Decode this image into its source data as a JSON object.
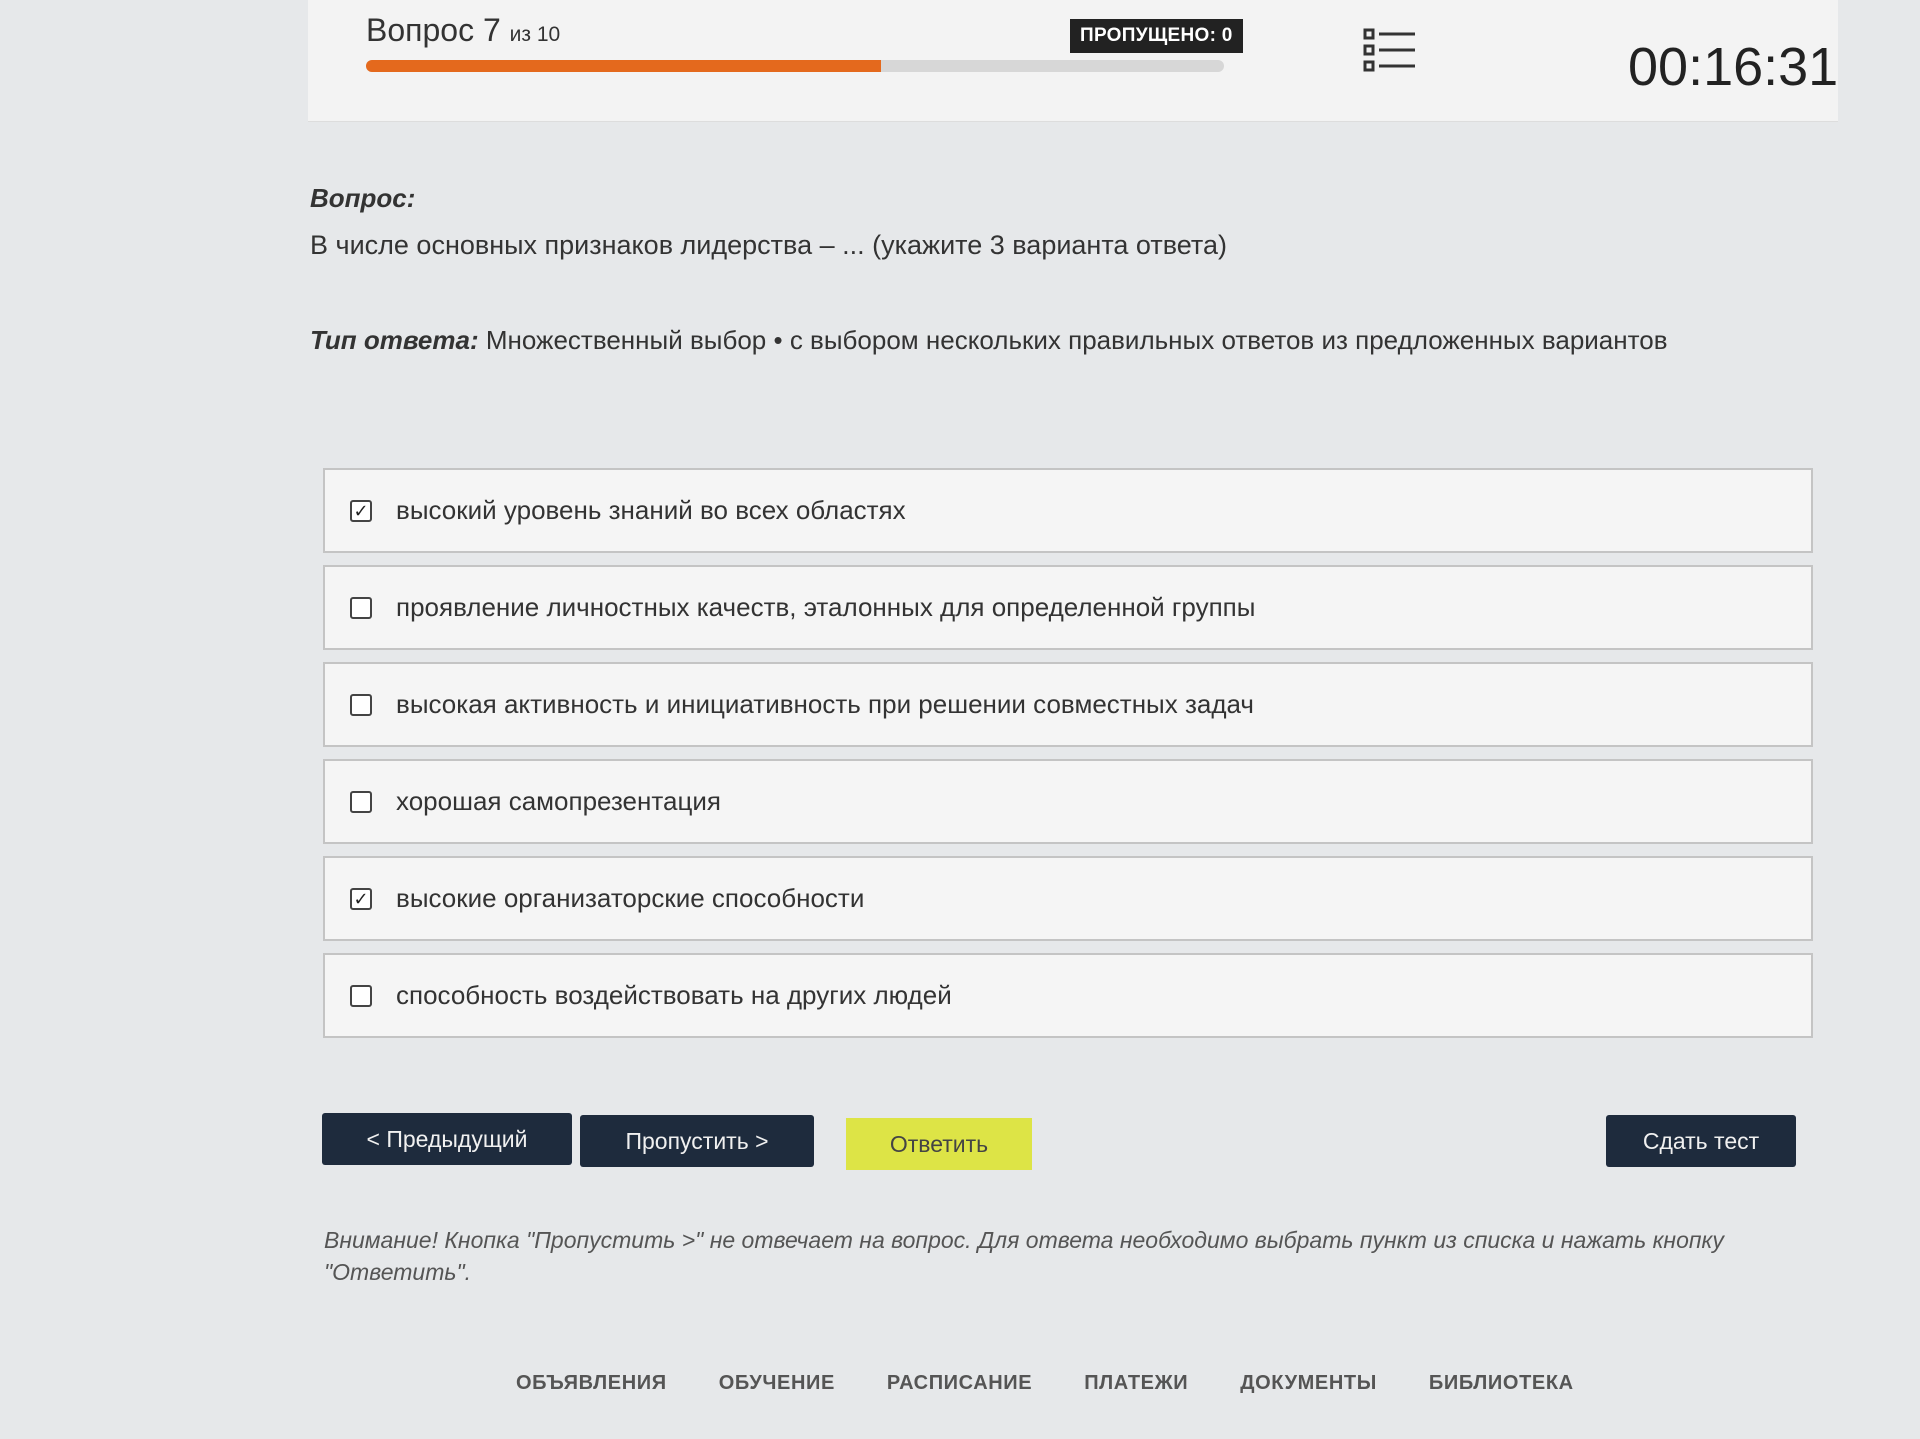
{
  "header": {
    "question_label": "Вопрос 7",
    "question_of": "из 10",
    "skipped_badge": "ПРОПУЩЕНО: 0",
    "progress_fraction": 0.6,
    "timer": "00:16:31"
  },
  "question": {
    "label": "Вопрос:",
    "text": "В числе основных признаков лидерства – ... (укажите 3 варианта ответа)",
    "answer_type_label": "Тип ответа:",
    "answer_type_value": "Множественный выбор • с выбором нескольких правильных ответов из предложенных вариантов"
  },
  "options": [
    {
      "text": "высокий уровень знаний во всех областях",
      "checked": true
    },
    {
      "text": "проявление личностных качеств, эталонных для определенной группы",
      "checked": false
    },
    {
      "text": "высокая активность и инициативность при решении совместных задач",
      "checked": false
    },
    {
      "text": "хорошая самопрезентация",
      "checked": false
    },
    {
      "text": "высокие организаторские способности",
      "checked": true
    },
    {
      "text": "способность воздействовать на других людей",
      "checked": false
    }
  ],
  "buttons": {
    "prev": "< Предыдущий",
    "skip": "Пропустить >",
    "answer": "Ответить",
    "submit": "Сдать тест"
  },
  "notice": "Внимание! Кнопка \"Пропустить >\" не отвечает на вопрос. Для ответа необходимо выбрать пункт из списка и нажать кнопку \"Ответить\".",
  "footer_nav": [
    "ОБЪЯВЛЕНИЯ",
    "ОБУЧЕНИЕ",
    "РАСПИСАНИЕ",
    "ПЛАТЕЖИ",
    "ДОКУМЕНТЫ",
    "БИБЛИОТЕКА"
  ],
  "colors": {
    "progress_fill": "#e4691d",
    "dark_button": "#1e2b3d",
    "answer_button": "#dde446"
  },
  "icons": {
    "question_list": "list-icon",
    "checkbox": "checkbox-icon"
  }
}
